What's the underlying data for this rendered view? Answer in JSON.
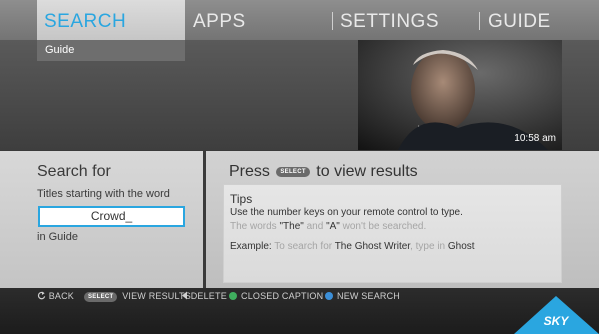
{
  "nav": {
    "search": "SEARCH",
    "apps": "APPS",
    "settings": "SETTINGS",
    "guide": "GUIDE"
  },
  "subtab": "Guide",
  "video": {
    "time": "10:58 am"
  },
  "search_panel": {
    "title": "Search for",
    "subtitle": "Titles starting with the word",
    "input_value": "Crowd_",
    "scope": "in Guide"
  },
  "results_panel": {
    "press": "Press",
    "select_pill": "SELECT",
    "to_view": "to view results",
    "tips_title": "Tips",
    "tip1": "Use the number keys on your remote control to type.",
    "tip2_a": "The words ",
    "tip2_the": "\"The\"",
    "tip2_and": " and ",
    "tip2_A": "\"A\"",
    "tip2_b": " won't be searched.",
    "tip3_label": "Example:",
    "tip3_a": " To search for ",
    "tip3_title": "The Ghost Writer",
    "tip3_b": ", type in ",
    "tip3_word": "Ghost"
  },
  "footer": {
    "back": "BACK",
    "select_pill": "SELECT",
    "view_results": "VIEW RESULTS",
    "delete": "DELETE",
    "closed_caption": "CLOSED CAPTION",
    "new_search": "NEW SEARCH",
    "logo": "SKY"
  },
  "colors": {
    "accent": "#2aa6e0",
    "green_button": "#3fae5e",
    "blue_button": "#3c8fd8"
  },
  "icons": {
    "back": "back-arrow-icon",
    "delete": "delete-arrow-icon",
    "green": "green-button-icon",
    "blue": "blue-button-icon"
  }
}
